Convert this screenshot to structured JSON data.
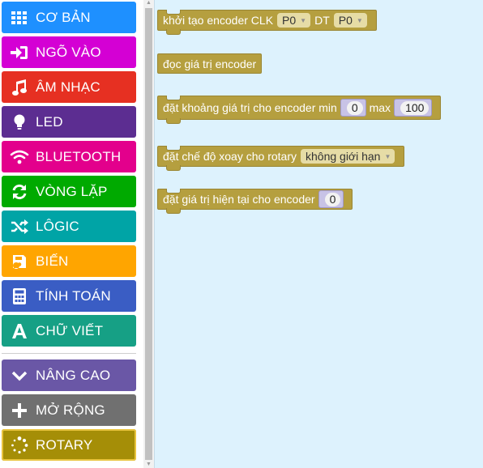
{
  "toolbox": {
    "categories": [
      {
        "label": "CƠ BẢN",
        "icon": "grid-icon",
        "color": "#1e90ff"
      },
      {
        "label": "NGÕ VÀO",
        "icon": "sign-in-icon",
        "color": "#d400d4"
      },
      {
        "label": "ÂM NHẠC",
        "icon": "music-note-icon",
        "color": "#e63022"
      },
      {
        "label": "LED",
        "icon": "lightbulb-icon",
        "color": "#5c2d91"
      },
      {
        "label": "BLUETOOTH",
        "icon": "wifi-icon",
        "color": "#e3008c"
      },
      {
        "label": "VÒNG LẶP",
        "icon": "refresh-icon",
        "color": "#00aa00"
      },
      {
        "label": "LÔGIC",
        "icon": "shuffle-icon",
        "color": "#00a4a6"
      },
      {
        "label": "BIẾN",
        "icon": "save-icon",
        "color": "#dc143c"
      },
      {
        "label": "TÍNH TOÁN",
        "icon": "calculator-icon",
        "color": "#3a5dc4"
      },
      {
        "label": "CHỮ VIẾT",
        "icon": "text-a-icon",
        "color": "#16a085"
      },
      {
        "label": "NÂNG CAO",
        "icon": "chevron-down-icon",
        "color": "#6a57a6"
      },
      {
        "label": "MỞ RỘNG",
        "icon": "plus-icon",
        "color": "#707070"
      },
      {
        "label": "ROTARY",
        "icon": "spinner-icon",
        "color": "#a58e07"
      }
    ]
  },
  "flyout": {
    "block_init": {
      "text1": "khởi tạo encoder CLK",
      "clk": "P0",
      "text2": "DT",
      "dt": "P0"
    },
    "block_read": {
      "text": "đọc giá trị encoder"
    },
    "block_range": {
      "text1": "đặt khoảng giá trị cho encoder min",
      "min": "0",
      "text2": "max",
      "max": "100"
    },
    "block_mode": {
      "text": "đặt chế độ xoay cho rotary",
      "mode": "không giới hạn"
    },
    "block_set": {
      "text": "đặt giá trị hiện tại cho encoder",
      "value": "0"
    }
  }
}
